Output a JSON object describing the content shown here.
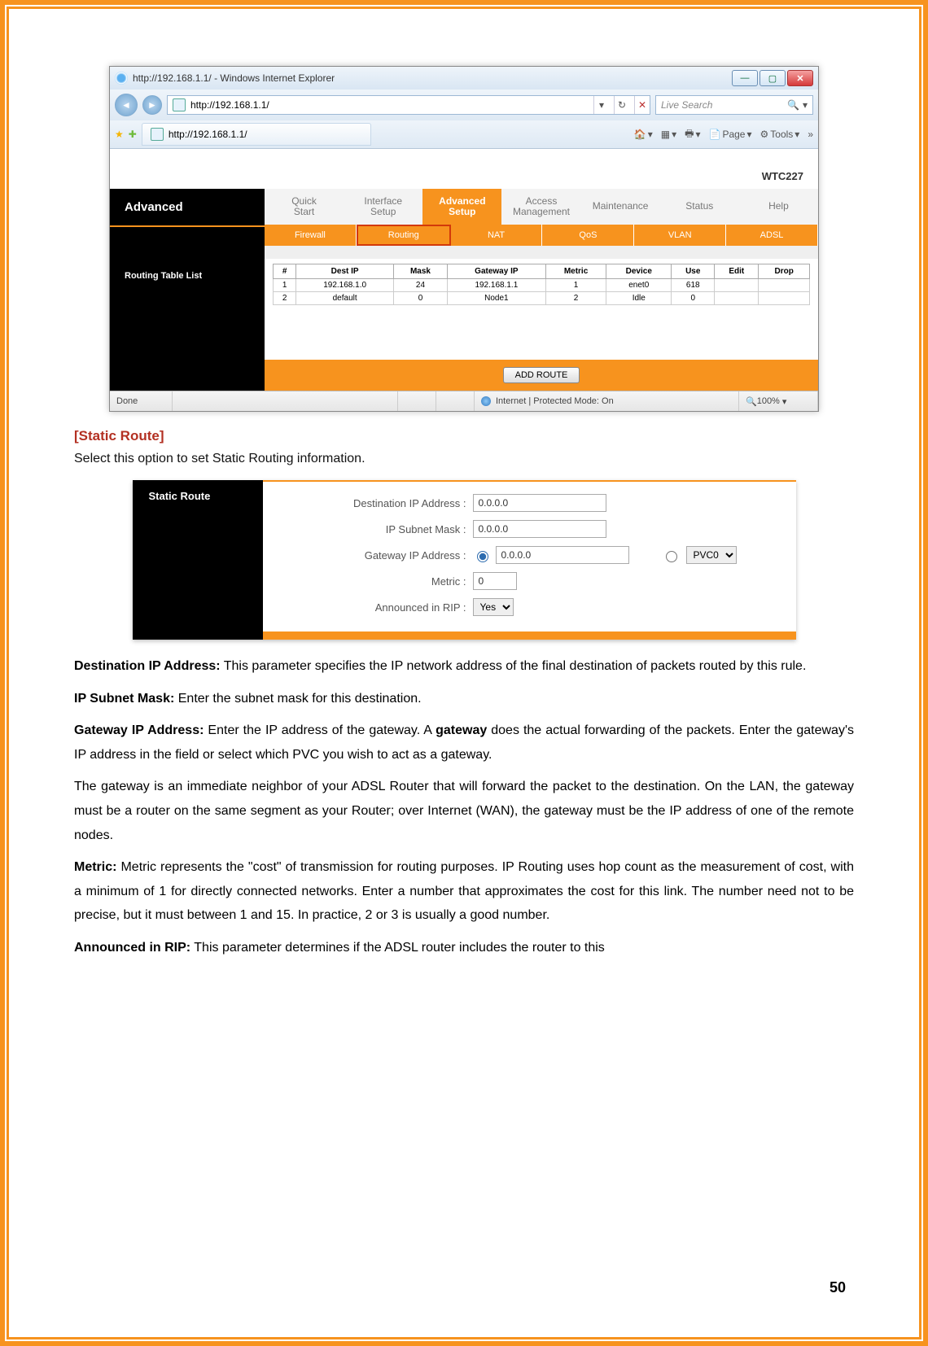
{
  "browser": {
    "title": "http://192.168.1.1/ - Windows Internet Explorer",
    "address": "http://192.168.1.1/",
    "search_placeholder": "Live Search",
    "tab_title": "http://192.168.1.1/",
    "toolbar_page": "Page",
    "toolbar_tools": "Tools",
    "status_done": "Done",
    "status_mode": "Internet | Protected Mode: On",
    "status_zoom": "100%"
  },
  "router": {
    "model": "WTC227",
    "left_title": "Advanced",
    "left_sub": "Routing Table List",
    "maintabs": [
      "Quick\nStart",
      "Interface\nSetup",
      "Advanced\nSetup",
      "Access\nManagement",
      "Maintenance",
      "Status",
      "Help"
    ],
    "maintabs_active_index": 2,
    "subtabs": [
      "Firewall",
      "Routing",
      "NAT",
      "QoS",
      "VLAN",
      "ADSL"
    ],
    "subtabs_active_index": 1,
    "columns": [
      "#",
      "Dest IP",
      "Mask",
      "Gateway IP",
      "Metric",
      "Device",
      "Use",
      "Edit",
      "Drop"
    ],
    "rows": [
      {
        "n": "1",
        "dest": "192.168.1.0",
        "mask": "24",
        "gw": "192.168.1.1",
        "metric": "1",
        "device": "enet0",
        "use": "618",
        "edit": "",
        "drop": ""
      },
      {
        "n": "2",
        "dest": "default",
        "mask": "0",
        "gw": "Node1",
        "metric": "2",
        "device": "Idle",
        "use": "0",
        "edit": "",
        "drop": ""
      }
    ],
    "add_route_label": "ADD ROUTE"
  },
  "section_heading": "[Static Route]",
  "section_intro": "Select this option to set Static Routing information.",
  "static_route": {
    "panel_title": "Static Route",
    "dest_label": "Destination IP Address :",
    "dest_value": "0.0.0.0",
    "mask_label": "IP Subnet Mask :",
    "mask_value": "0.0.0.0",
    "gw_label": "Gateway IP Address :",
    "gw_value": "0.0.0.0",
    "pvc_option": "PVC0",
    "metric_label": "Metric :",
    "metric_value": "0",
    "rip_label": "Announced in RIP :",
    "rip_value": "Yes"
  },
  "definitions": {
    "dest_head": "Destination IP Address:",
    "dest_body": " This parameter specifies the IP network address of the final destination of packets routed by this rule.",
    "mask_head": "IP Subnet Mask:",
    "mask_body": " Enter the subnet mask for this destination.",
    "gw_head": "Gateway IP Address:",
    "gw_body_1": " Enter the IP address of the gateway. A ",
    "gw_bold": "gateway",
    "gw_body_2": " does the actual forwarding of the packets. Enter the gateway's IP address in the field or select which PVC you wish to act as a gateway.",
    "gw_body_3": "The gateway is an immediate neighbor of your ADSL Router that will forward the packet to the destination. On the LAN, the gateway must be a router on the same segment as your Router; over Internet (WAN), the gateway must be the IP address of one of the remote nodes.",
    "metric_head": "Metric:",
    "metric_body": " Metric represents the \"cost\" of transmission for routing purposes. IP Routing uses hop count as the measurement of cost, with a minimum of 1 for directly connected networks. Enter a number that approximates the cost for this link. The number need not to be precise, but it must between 1 and 15. In practice, 2 or 3 is usually a good number.",
    "rip_head": "Announced in RIP:",
    "rip_body": " This parameter determines if the ADSL router includes the router to this"
  },
  "page_number": "50"
}
